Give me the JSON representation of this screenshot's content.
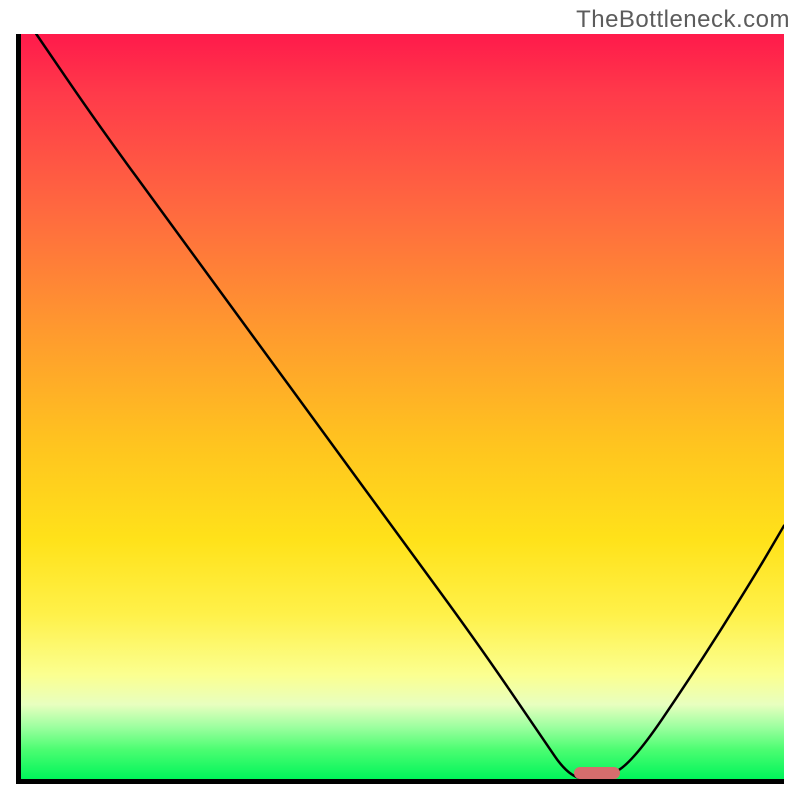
{
  "watermark": "TheBottleneck.com",
  "chart_data": {
    "type": "line",
    "title": "",
    "xlabel": "",
    "ylabel": "",
    "xlim": [
      0,
      100
    ],
    "ylim": [
      0,
      100
    ],
    "grid": false,
    "legend": false,
    "series": [
      {
        "name": "bottleneck-curve",
        "x": [
          2,
          10,
          20,
          30,
          40,
          50,
          60,
          68,
          72,
          76,
          80,
          88,
          96,
          100
        ],
        "values": [
          100,
          88,
          74,
          60,
          46,
          32,
          18,
          6,
          0,
          0,
          2,
          14,
          27,
          34
        ]
      }
    ],
    "annotations": [
      {
        "name": "optimal-marker",
        "x_start": 72,
        "x_end": 78,
        "y": 0.8,
        "color": "#d66d6d"
      }
    ],
    "background": "vertical-rainbow (red top → green bottom)"
  }
}
